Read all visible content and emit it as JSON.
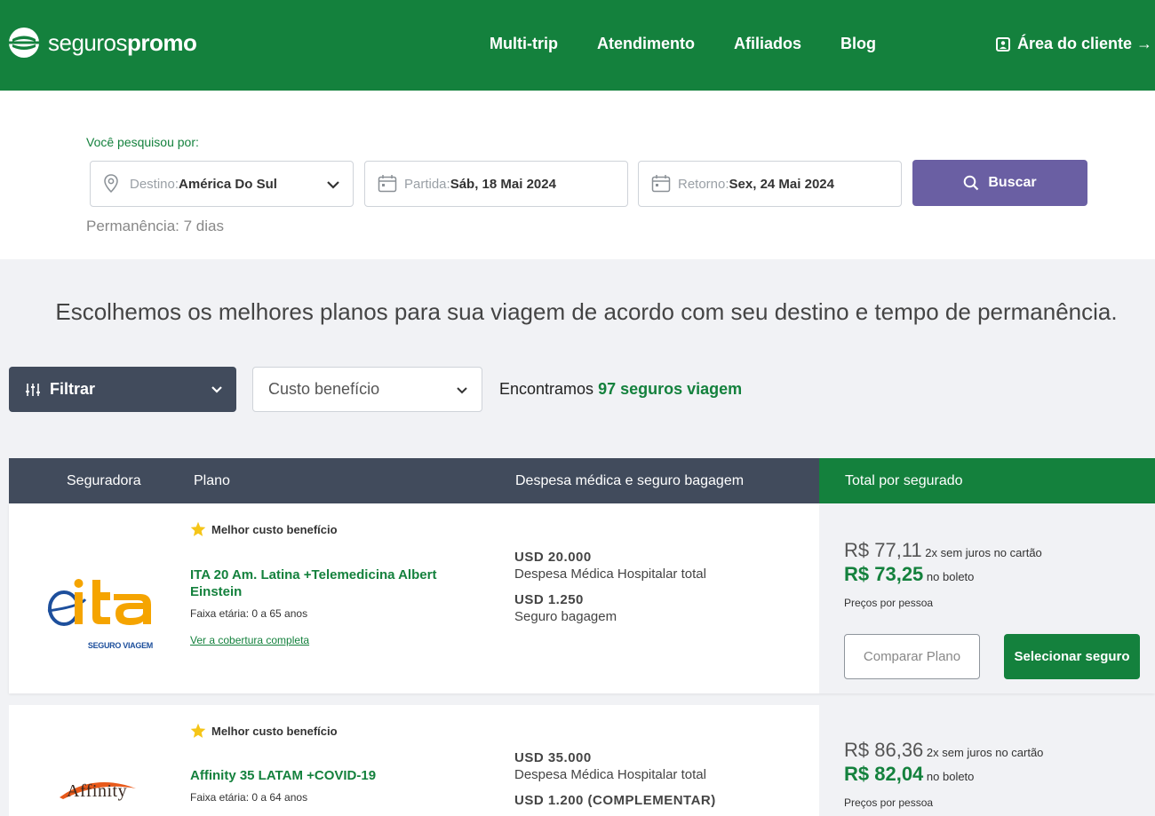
{
  "header": {
    "logo_light": "seguros",
    "logo_bold": "promo",
    "nav": [
      "Multi-trip",
      "Atendimento",
      "Afiliados",
      "Blog"
    ],
    "client_area": "Área do cliente →"
  },
  "search": {
    "label": "Você pesquisou por:",
    "destination_label": "Destino:",
    "destination_value": "América Do Sul",
    "departure_label": "Partida: ",
    "departure_value": "Sáb, 18 Mai 2024",
    "return_label": "Retorno: ",
    "return_value": "Sex, 24 Mai 2024",
    "button": "Buscar",
    "stay": "Permanência: 7 dias"
  },
  "headline": "Escolhemos os melhores planos para sua viagem de acordo com seu destino e tempo de permanência.",
  "filters": {
    "filter_button": "Filtrar",
    "sort_selected": "Custo benefício",
    "found_prefix": "Encontramos ",
    "found_highlight": "97 seguros viagem"
  },
  "table": {
    "headers": [
      "Seguradora",
      "Plano",
      "Despesa médica e seguro bagagem",
      "Total por segurado"
    ]
  },
  "plans": [
    {
      "insurer": "ita",
      "insurer_sub": "SEGURO VIAGEM",
      "badge": "Melhor custo benefício",
      "name": "ITA 20 Am. Latina +Telemedicina Albert Einstein",
      "age": "Faixa etária: 0 a 65 anos",
      "cover_link": "Ver a cobertura completa",
      "medical_amount": "USD 20.000",
      "medical_desc": "Despesa Médica Hospitalar total",
      "baggage_amount": "USD 1.250",
      "baggage_desc": "Seguro bagagem",
      "price_card": "R$ 77,11",
      "price_card_note": " 2x sem juros no cartão",
      "price_boleto": "R$ 73,25",
      "price_boleto_note": " no boleto",
      "price_note": "Preços por pessoa",
      "compare": "Comparar Plano",
      "select": "Selecionar seguro"
    },
    {
      "insurer": "Affinity",
      "badge": "Melhor custo benefício",
      "name": "Affinity 35 LATAM +COVID-19",
      "age": "Faixa etária: 0 a 64 anos",
      "medical_amount": "USD 35.000",
      "medical_desc": "Despesa Médica Hospitalar total",
      "baggage_amount": "USD 1.200 (COMPLEMENTAR)",
      "price_card": "R$ 86,36",
      "price_card_note": " 2x sem juros no cartão",
      "price_boleto": "R$ 82,04",
      "price_boleto_note": " no boleto",
      "price_note": "Preços por pessoa"
    }
  ],
  "colors": {
    "brand_green": "#14813d",
    "dark_slate": "#414b5c",
    "search_purple": "#6a5fa3",
    "star": "#f5c518"
  }
}
